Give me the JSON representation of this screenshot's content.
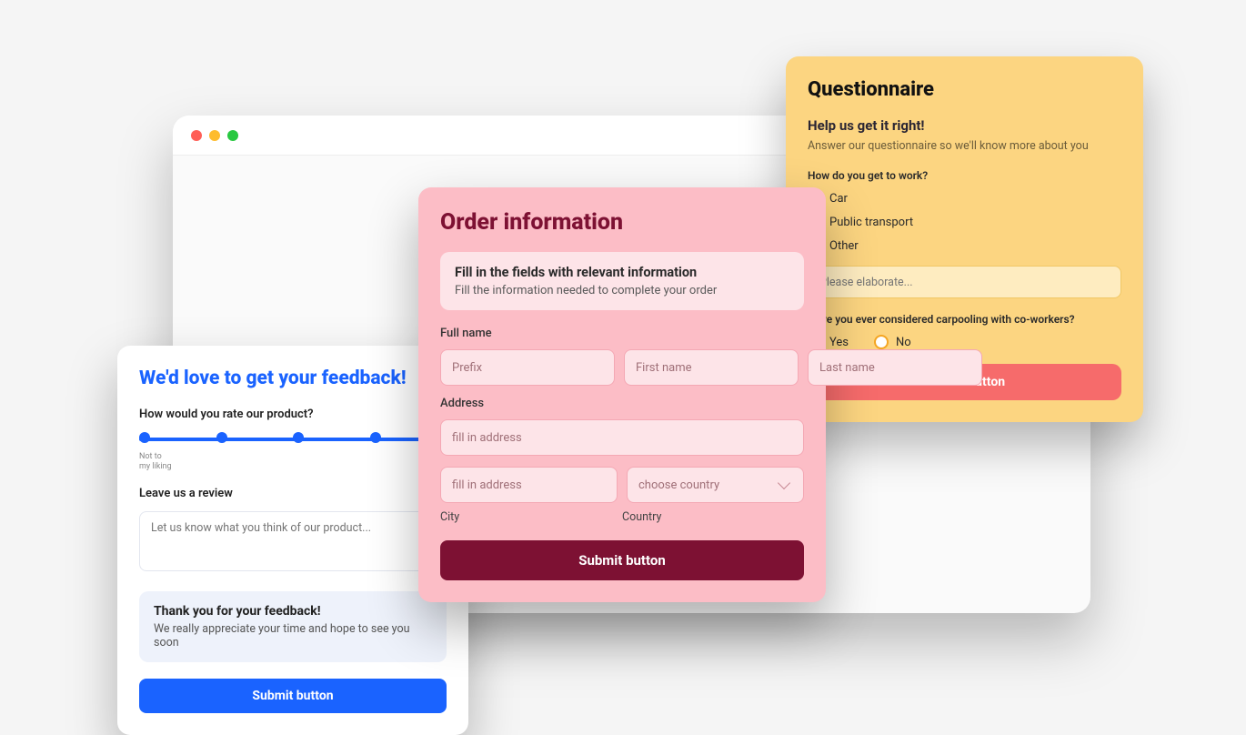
{
  "questionnaire": {
    "title": "Questionnaire",
    "subhead": "Help us get it right!",
    "subdesc": "Answer our questionnaire so we'll know more about you",
    "q1": {
      "label": "How do you get to work?",
      "options": [
        "Car",
        "Public transport",
        "Other"
      ],
      "elaborate_placeholder": "Please elaborate..."
    },
    "q2": {
      "label": "Have you ever considered carpooling with co-workers?",
      "options": [
        "Yes",
        "No"
      ]
    },
    "submit": "Submit button"
  },
  "feedback": {
    "title": "We'd love to get your feedback!",
    "q_rate": "How would you rate our product?",
    "slider_min_label": "Not to\nmy liking",
    "review_label": "Leave us a review",
    "review_placeholder": "Let us know what you think of our product...",
    "thank_title": "Thank you for your feedback!",
    "thank_body": "We really appreciate your time and hope to see you soon",
    "submit": "Submit button"
  },
  "order": {
    "title": "Order information",
    "box_title": "Fill in the fields with relevant information",
    "box_body": "Fill the information needed to complete your order",
    "fullname_label": "Full name",
    "prefix_placeholder": "Prefix",
    "first_placeholder": "First name",
    "last_placeholder": "Last name",
    "address_label": "Address",
    "address_placeholder": "fill in address",
    "country_placeholder": "choose country",
    "city_label": "City",
    "country_label": "Country",
    "submit": "Submit button"
  }
}
